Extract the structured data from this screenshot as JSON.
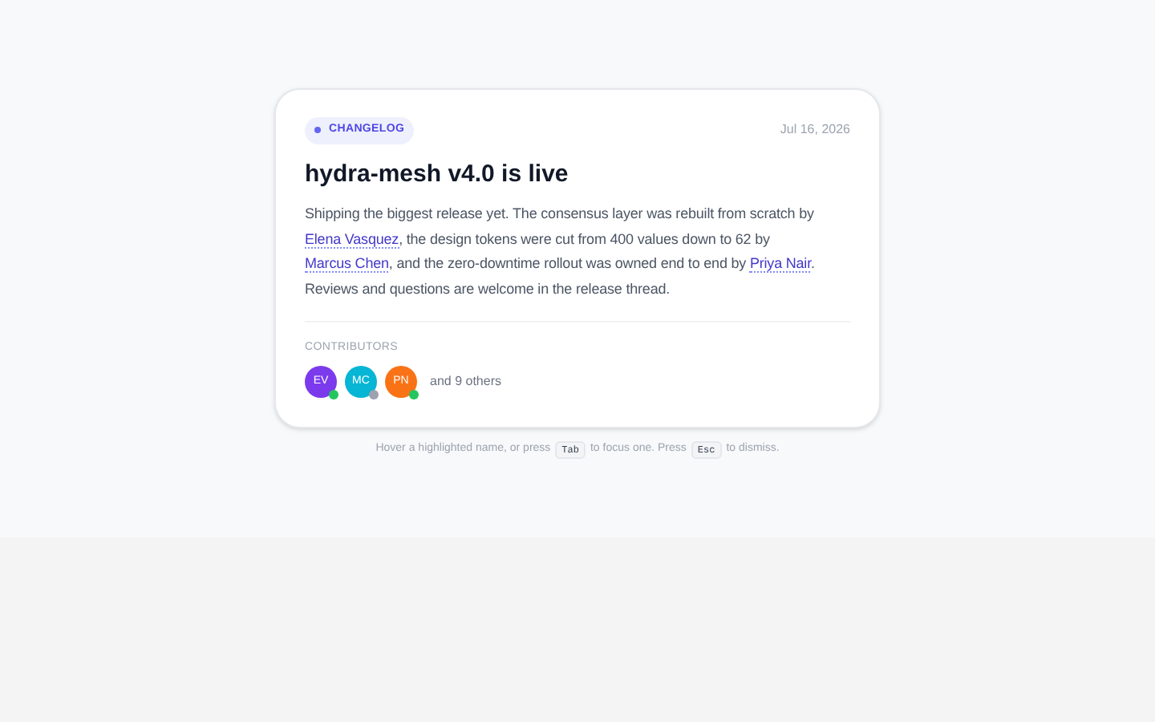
{
  "card": {
    "badge": "CHANGELOG",
    "date": "Jul 16, 2026",
    "title": "hydra-mesh v4.0 is live",
    "body": [
      {
        "kind": "text",
        "text": "Shipping the biggest release yet. The consensus layer was rebuilt from scratch by "
      },
      {
        "kind": "mention",
        "text": "Elena Vasquez"
      },
      {
        "kind": "text",
        "text": ", the design tokens were cut from 400 values down to 62 by "
      },
      {
        "kind": "mention",
        "text": "Marcus Chen"
      },
      {
        "kind": "text",
        "text": ", and the zero-downtime rollout was owned end to end by "
      },
      {
        "kind": "mention",
        "text": "Priya Nair"
      },
      {
        "kind": "text",
        "text": ". Reviews and questions are welcome in the release thread."
      }
    ],
    "contributors_label": "CONTRIBUTORS",
    "contributors": [
      {
        "initials": "EV",
        "color": "#7c3aed",
        "status": {
          "color": "#22c55e"
        }
      },
      {
        "initials": "MC",
        "color": "#06b6d4",
        "status": {
          "color": "#9ca3af"
        }
      },
      {
        "initials": "PN",
        "color": "#f97316",
        "status": {
          "color": "#22c55e"
        }
      }
    ],
    "others": "and 9 others"
  },
  "hint": [
    {
      "kind": "text",
      "text": "Hover a highlighted name, or press"
    },
    {
      "kind": "key",
      "text": "Tab"
    },
    {
      "kind": "text",
      "text": "to focus one. Press"
    },
    {
      "kind": "key",
      "text": "Esc"
    },
    {
      "kind": "text",
      "text": "to dismiss."
    }
  ]
}
